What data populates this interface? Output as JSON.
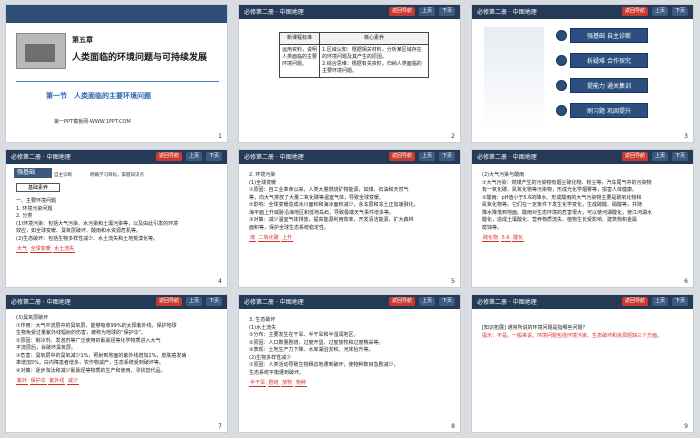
{
  "header": {
    "title": "必修第二册 · 中图地理",
    "nav_label": "返回导航",
    "prev_label": "上页",
    "next_label": "下页"
  },
  "slides": [
    {
      "page": "1",
      "chapter": "第五章",
      "title": "人类面临的环境问题与可持续发展",
      "section": "第一节　人类面临的主要环境问题",
      "footer": "第一PPT模板网-WWW.1PPT.COM"
    },
    {
      "page": "2",
      "col1_header": "新课程标准",
      "col2_header": "核心素养",
      "col1_text": "运用资料，说明人类面临的主要环境问题。",
      "col2_items": [
        "1.区域认知：根据相关材料，分析某区域存在的环境问题及其产生的原因。",
        "2.综合思维：根据有关资料，归纳人类面临的主要环境问题。"
      ]
    },
    {
      "page": "3",
      "menu": [
        "强基础 自主诊断",
        "析疑难 合作探究",
        "提能力 通关集训",
        "刷习题 巩固提升"
      ]
    },
    {
      "page": "4",
      "tag": "强基础",
      "tag_note": "自主诊断　　　　明确学习目标，掌握知识点",
      "sub": "基础素养",
      "lines": [
        "一、主要环境问题",
        "1. 环境污染问题",
        "2. 分类",
        "(1)环境污染：包括大气污染、水污染和土壤污染等，以及由此引发的环境",
        "效应，如全球变暖、臭氧层破坏、酸雨和水资源危机等。",
        "(2)生态破坏：包括生物多样性减少、水土流失和土地荒漠化等。"
      ],
      "blanks": [
        "大气",
        "全球变暖",
        "水土流失"
      ]
    },
    {
      "page": "5",
      "lines": [
        "2. 环境污染",
        "(1)全球变暖",
        "①原因：自工业革命以来，人类大量燃烧矿物能源，如煤、石油和天然气",
        "等，向大气排放了大量二氧化碳等温室气体，导致全球变暖。",
        "②影响：全球变暖造成冰川面积和海冰面积减少，永冻层和冻土正加速融化，",
        "海平面上升威胁沿海地区和低地岛屿，导致极端天气事件增多等。",
        "③对策：减少温室气体排放，提高能源利用效率，开发清洁能源，扩大森林",
        "面积等，保护全球生态系统稳定性。"
      ],
      "blanks": [
        "煤",
        "二氧化碳",
        "上升"
      ]
    },
    {
      "page": "6",
      "lines": [
        "(2)大气污染与酸雨",
        "①大气污染：燃煤产生的污染物有烟尘硫化物、粉尘等，汽车尾气中的污染物",
        "有一氧化碳、氮氧化物等污染物，形成光化学烟雾等，损害人体健康。",
        "②酸雨：pH值小于5.6的降水。形成酸雨的大气污染物主要是硫氧化物和",
        "氮氧化物等。它们在一定条件下发生化学变化，生成硫酸、硝酸等，并随",
        "降水降落到地面。酸雨对生态环境的危害很大，可以使河湖酸化，使江河湖水",
        "酸化，造成土壤酸化、营养物质流失、植物生长受影响、建筑物和金属",
        "腐蚀等。"
      ],
      "blanks": [
        "硫化物",
        "5.6",
        "酸化"
      ]
    },
    {
      "page": "7",
      "lines": [
        "(3)臭氧层破坏",
        "①作用：大气平流层中的臭氧层，能够吸收99%的太阳紫外线，保护地球",
        "生物免受过量紫外线辐射的伤害，被称为地球的“保护伞”。",
        "②原因：制冷剂、发泡剂等广泛使用的氟氯烃等化学物质进入大气",
        "平流层后，会破坏臭氧层。",
        "③危害：臭氧层中的臭氧减少1%，照射到地面的紫外线增加2%，皮肤癌发病",
        "率增加5%，白内障患者增多，农作物减产，生态系统受到破坏等。",
        "④对策：逐步淘汰和减少氟氯烃等物质的生产和使用，寻找替代品。"
      ],
      "blanks": [
        "紫外",
        "保护伞",
        "紫外线",
        "减少"
      ]
    },
    {
      "page": "8",
      "lines": [
        "3. 生态破坏",
        "(1)水土流失",
        "①分布：主要发生在干旱、半干旱和半湿润地区。",
        "②原因：人口数量剧增，过度开垦、过度放牧和过度樵采等。",
        "③表现：土地生产力下降、水库湖泊淤积、河床抬升等。",
        "(2)生物多样性减少",
        "①原因：人类活动导致生物栖息地遭到破坏，使物种数目急剧减少，",
        "生态系统平衡遭到破坏。"
      ],
      "blanks": [
        "半干旱",
        "剧增",
        "放牧",
        "物种"
      ]
    },
    {
      "page": "9",
      "lines": [
        "[知识拓展] 通常所说的环境问题是指哪些问题？",
        "提示：不是。一般来说，环境问题包括环境污染、生态破坏和资源短缺三个方面。"
      ]
    }
  ]
}
